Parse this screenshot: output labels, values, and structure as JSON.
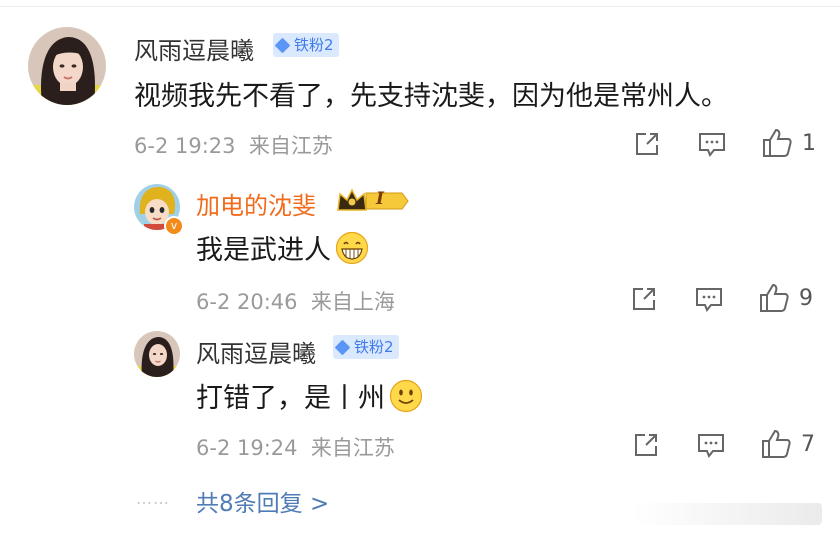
{
  "comment": {
    "user": "风雨逗晨曦",
    "badge": "铁粉2",
    "text": "视频我先不看了，先支持沈斐，因为他是常州人。",
    "time": "6-2 19:23",
    "location": "来自江苏",
    "likes": "1"
  },
  "replies": [
    {
      "user": "加电的沈斐",
      "rank": "I",
      "text": "我是武进人",
      "time": "6-2 20:46",
      "location": "来自上海",
      "likes": "9"
    },
    {
      "user": "风雨逗晨曦",
      "badge": "铁粉2",
      "text": "打错了，是丨州",
      "time": "6-2 19:24",
      "location": "来自江苏",
      "likes": "7"
    }
  ],
  "more": {
    "dots": "……",
    "label": "共8条回复 >"
  },
  "colors": {
    "name": "#333333",
    "vip_name": "#f26b1d",
    "meta": "#9a9a9a",
    "link": "#4f7cb4",
    "badge_bg": "#dbe9ff"
  }
}
